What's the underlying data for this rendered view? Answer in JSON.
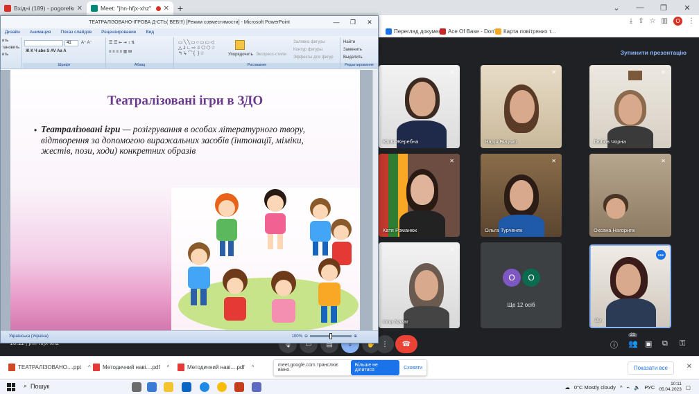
{
  "browser": {
    "tabs": [
      {
        "title": "Вхідні (189) - pogorelko70@gmai",
        "icon": "gmail-icon",
        "color": "#d93025"
      },
      {
        "title": "Meet: \"jhn-hfjx-xhz\"",
        "icon": "meet-icon",
        "color": "#00897b"
      }
    ],
    "new_tab": "+",
    "window_controls": [
      "⌄",
      "—",
      "❐",
      "✕"
    ],
    "profile_initial": "O"
  },
  "bookmarks": [
    {
      "label": "Перегляд докумен...",
      "color": "#1a73e8"
    },
    {
      "label": "Ace Of Base - Don't...",
      "color": "#c62828"
    },
    {
      "label": "Карта повітряних т...",
      "color": "#f9a825"
    }
  ],
  "powerpoint": {
    "window_title": "ТЕАТРАЛІЗОВАНО-ІГРОВА Д-СТЬ( ВЕБ!!!) [Режим совместимости] - Microsoft PowerPoint",
    "menu": [
      "Дизайн",
      "Анимация",
      "Показ слайдов",
      "Рецензирование",
      "Вид"
    ],
    "ribbon": {
      "font_size": "41",
      "group_font": "Шрифт",
      "group_paragraph": "Абзац",
      "group_drawing": "Рисование",
      "group_editing": "Редактирование",
      "arrange": "Упорядочить",
      "quick_styles": "Экспресс-стили",
      "shape_fill": "Заливка фигуры",
      "shape_outline": "Контур фигуры",
      "shape_effects": "Эффекты для фигур",
      "find": "Найти",
      "replace": "Заменить",
      "select": "Выделить",
      "left_labels": [
        "ить",
        "тановить",
        "ить"
      ]
    },
    "slide": {
      "title": "Театралізовані ігри в ЗДО",
      "bullet": "•",
      "term": "Театралізовані ігри",
      "definition": " — розігрування в особах літературного твору, відтворення за допомогою виражальних засобів (інтонації, міміки, жестів, пози, ходи) конкретних образів"
    },
    "status": {
      "lang": "Українська (Україна)",
      "zoom": "100%"
    }
  },
  "meet": {
    "stop_presenting": "Зупинити презентацію",
    "meeting_code": "10:11 | jhn-hfjx-xhz",
    "participants": [
      {
        "name": "Юлія Жеребна"
      },
      {
        "name": "Надія Бицько"
      },
      {
        "name": "Любов Чорна"
      },
      {
        "name": "Катя Романюк"
      },
      {
        "name": "Ольга Турченяк"
      },
      {
        "name": "Оксана Нагорняк"
      },
      {
        "name": "Inna Nazar"
      },
      {
        "name": "Ви"
      }
    ],
    "more_tile": {
      "label": "Ще 12 осіб",
      "avatars": [
        "O",
        "O"
      ],
      "colors": [
        "#7e57c2",
        "#0b6b4f"
      ]
    },
    "participant_count": "21",
    "tile_menu": "•••"
  },
  "downloads": [
    {
      "name": "ТЕАТРАЛІЗОВАНО....ppt",
      "color": "#d24726"
    },
    {
      "name": "Методичний наві....pdf",
      "color": "#e53935"
    },
    {
      "name": "Методичний наві....pdf",
      "color": "#e53935"
    }
  ],
  "share_bar": {
    "message": "meet.google.com транслює вікно.",
    "share_button": "Більше не ділитися",
    "hide": "Сховати"
  },
  "show_all": "Показати все",
  "taskbar": {
    "search": "Пошук",
    "weather": "0°C  Mostly cloudy",
    "lang": "РУС",
    "time": "10:11",
    "date": "05.04.2023"
  }
}
